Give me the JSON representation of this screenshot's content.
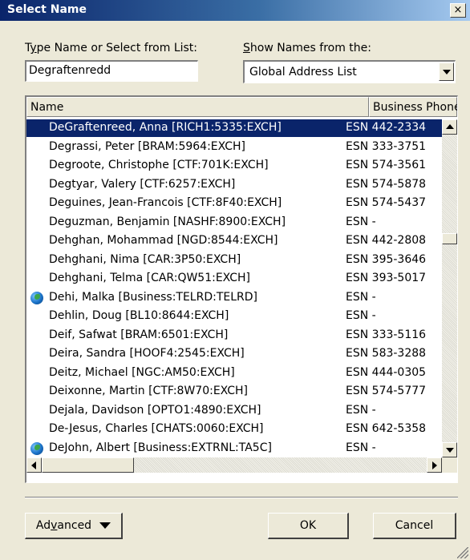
{
  "window": {
    "title": "Select Name",
    "close_glyph": "×"
  },
  "type_name": {
    "label_pre": "T",
    "label_accel": "y",
    "label_post": "pe Name or Select from List:",
    "value": "Degraftenredd"
  },
  "show_names": {
    "label_accel": "S",
    "label_post": "how Names from the:",
    "selected": "Global Address List"
  },
  "list": {
    "columns": [
      "Name",
      "Business Phone"
    ],
    "selected_index": 0,
    "rows": [
      {
        "name": "DeGraftenreed, Anna [RICH1:5335:EXCH]",
        "phone": "ESN 442-2334",
        "icon": ""
      },
      {
        "name": "Degrassi, Peter [BRAM:5964:EXCH]",
        "phone": "ESN 333-3751",
        "icon": ""
      },
      {
        "name": "Degroote, Christophe [CTF:701K:EXCH]",
        "phone": "ESN 574-3561",
        "icon": ""
      },
      {
        "name": "Degtyar, Valery [CTF:6257:EXCH]",
        "phone": "ESN 574-5878",
        "icon": ""
      },
      {
        "name": "Deguines, Jean-Francois [CTF:8F40:EXCH]",
        "phone": "ESN 574-5437",
        "icon": ""
      },
      {
        "name": "Deguzman, Benjamin [NASHF:8900:EXCH]",
        "phone": "ESN -",
        "icon": ""
      },
      {
        "name": "Dehghan, Mohammad [NGD:8544:EXCH]",
        "phone": "ESN 442-2808",
        "icon": ""
      },
      {
        "name": "Dehghani, Nima [CAR:3P50:EXCH]",
        "phone": "ESN 395-3646",
        "icon": ""
      },
      {
        "name": "Dehghani, Telma [CAR:QW51:EXCH]",
        "phone": "ESN 393-5017",
        "icon": ""
      },
      {
        "name": "Dehi, Malka [Business:TELRD:TELRD]",
        "phone": "ESN -",
        "icon": "globe-icon"
      },
      {
        "name": "Dehlin, Doug [BL10:8644:EXCH]",
        "phone": "ESN -",
        "icon": ""
      },
      {
        "name": "Deif, Safwat [BRAM:6501:EXCH]",
        "phone": "ESN 333-5116",
        "icon": ""
      },
      {
        "name": "Deira, Sandra [HOOF4:2545:EXCH]",
        "phone": "ESN 583-3288",
        "icon": ""
      },
      {
        "name": "Deitz, Michael [NGC:AM50:EXCH]",
        "phone": "ESN 444-0305",
        "icon": ""
      },
      {
        "name": "Deixonne, Martin [CTF:8W70:EXCH]",
        "phone": "ESN 574-5777",
        "icon": ""
      },
      {
        "name": "Dejala, Davidson [OPTO1:4890:EXCH]",
        "phone": "ESN -",
        "icon": ""
      },
      {
        "name": "De-Jesus, Charles [CHATS:0060:EXCH]",
        "phone": "ESN 642-5358",
        "icon": ""
      },
      {
        "name": "DeJohn, Albert [Business:EXTRNL:TA5C]",
        "phone": "ESN -",
        "icon": "globe-icon"
      }
    ]
  },
  "buttons": {
    "advanced_pre": "Ad",
    "advanced_accel": "v",
    "advanced_post": "anced",
    "ok": "OK",
    "cancel": "Cancel"
  },
  "colors": {
    "selection": "#0a246a",
    "title_gradient_start": "#0a246a",
    "dialog_face": "#ece9d8"
  }
}
